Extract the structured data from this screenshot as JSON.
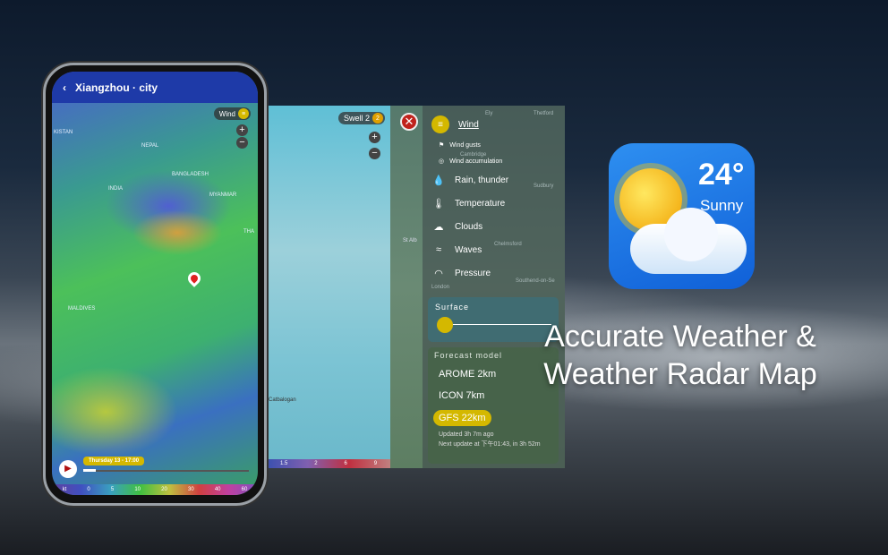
{
  "headline": {
    "line1": "Accurate Weather &",
    "line2": "Weather Radar Map"
  },
  "app_icon": {
    "temperature": "24°",
    "condition": "Sunny"
  },
  "phone": {
    "title": "Xiangzhou · city",
    "layer_pill": "Wind",
    "map_labels": [
      "KISTAN",
      "NEPAL",
      "INDIA",
      "BANGLADESH",
      "MYANMAR",
      "THA",
      "MALDIVES"
    ],
    "timeline_label": "Thursday 13 - 17:00",
    "scale": [
      "kt",
      "0",
      "5",
      "10",
      "20",
      "30",
      "40",
      "60"
    ]
  },
  "swell_panel": {
    "layer_pill": "Swell 2",
    "badge": "2",
    "map_labels": [
      "Catbalogan"
    ],
    "scale": [
      "1.5",
      "2",
      "6",
      "9"
    ]
  },
  "menu": {
    "items": [
      {
        "label": "Wind",
        "icon": "wind-icon",
        "selected": true
      },
      {
        "label": "Wind gusts",
        "icon": "flag-icon",
        "sub": true
      },
      {
        "label": "Wind accumulation",
        "icon": "cyclone-icon",
        "sub": true
      },
      {
        "label": "Rain, thunder",
        "icon": "drop-icon"
      },
      {
        "label": "Temperature",
        "icon": "thermometer-icon"
      },
      {
        "label": "Clouds",
        "icon": "cloud-icon"
      },
      {
        "label": "Waves",
        "icon": "waves-icon"
      },
      {
        "label": "Pressure",
        "icon": "gauge-icon"
      }
    ],
    "surface_label": "Surface",
    "surface_level": 0,
    "forecast_title": "Forecast model",
    "models": [
      "AROME 2km",
      "ICON 7km",
      "GFS 22km"
    ],
    "selected_model": "GFS 22km",
    "updated": "Updated 3h 7m ago",
    "next_update": "Next update at 下午01:43, in 3h 52m",
    "map_labels": [
      "Ely",
      "Thetford",
      "Cambridge",
      "Sudbury",
      "Chelmsford",
      "St Alb",
      "London",
      "Southend-on-Se"
    ]
  },
  "colors": {
    "accent": "#d4b800",
    "header": "#1e3aa8",
    "close": "#c0221c"
  }
}
